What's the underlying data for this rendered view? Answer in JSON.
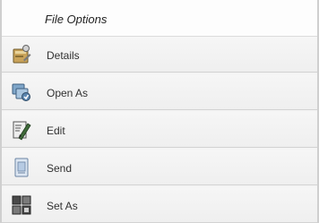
{
  "menu": {
    "title": "File Options",
    "items": [
      {
        "label": "Details",
        "icon": "details-icon"
      },
      {
        "label": "Open As",
        "icon": "open-as-icon"
      },
      {
        "label": "Edit",
        "icon": "edit-icon"
      },
      {
        "label": "Send",
        "icon": "send-icon"
      },
      {
        "label": "Set As",
        "icon": "set-as-icon"
      }
    ]
  },
  "colors": {
    "header_bg": "#fdfdfd",
    "item_bg": "#f2f2f2",
    "divider": "#d2d2d2",
    "text": "#303030"
  }
}
